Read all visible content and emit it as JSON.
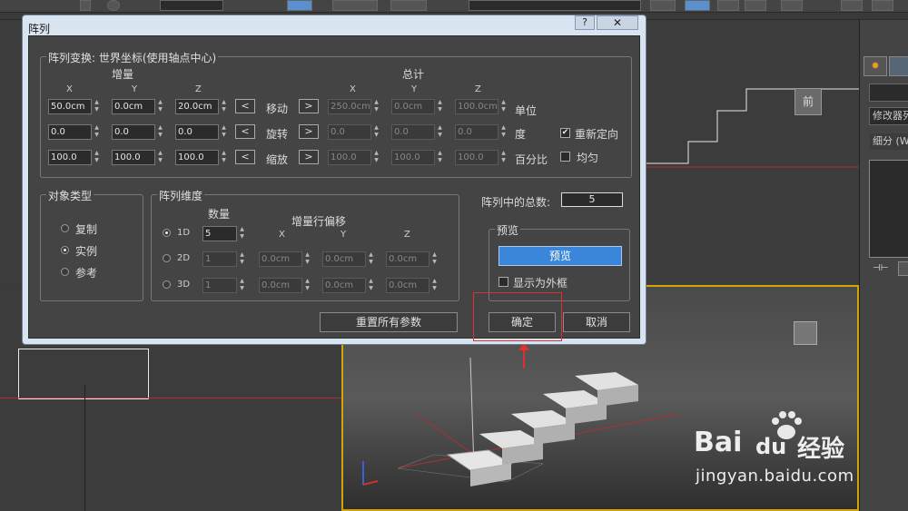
{
  "dialog": {
    "title": "阵列",
    "help_label": "?",
    "close_label": "✕",
    "transform_group": {
      "title": "阵列变换: 世界坐标(使用轴点中心)",
      "increment_header": "增量",
      "total_header": "总计",
      "axes": [
        "X",
        "Y",
        "Z"
      ],
      "rows": [
        {
          "label": "移动",
          "increment": [
            "50.0cm",
            "0.0cm",
            "20.0cm"
          ],
          "total": [
            "250.0cm",
            "0.0cm",
            "100.0cm"
          ],
          "suffix": "单位",
          "left_arrow": "<",
          "right_arrow": ">"
        },
        {
          "label": "旋转",
          "increment": [
            "0.0",
            "0.0",
            "0.0"
          ],
          "total": [
            "0.0",
            "0.0",
            "0.0"
          ],
          "suffix": "度",
          "left_arrow": "<",
          "right_arrow": ">"
        },
        {
          "label": "缩放",
          "increment": [
            "100.0",
            "100.0",
            "100.0"
          ],
          "total": [
            "100.0",
            "100.0",
            "100.0"
          ],
          "suffix": "百分比",
          "left_arrow": "<",
          "right_arrow": ">"
        }
      ],
      "reorient_label": "重新定向",
      "reorient_checked": true,
      "uniform_label": "均匀",
      "uniform_checked": false
    },
    "object_type_group": {
      "title": "对象类型",
      "options": [
        "复制",
        "实例",
        "参考"
      ],
      "selected": "实例"
    },
    "dimensions_group": {
      "title": "阵列维度",
      "count_header": "数量",
      "offset_header": "增量行偏移",
      "axes": [
        "X",
        "Y",
        "Z"
      ],
      "rows": [
        {
          "label": "1D",
          "count": "5",
          "offsets": [
            "",
            "",
            ""
          ],
          "selected": true
        },
        {
          "label": "2D",
          "count": "1",
          "offsets": [
            "0.0cm",
            "0.0cm",
            "0.0cm"
          ],
          "selected": false
        },
        {
          "label": "3D",
          "count": "1",
          "offsets": [
            "0.0cm",
            "0.0cm",
            "0.0cm"
          ],
          "selected": false
        }
      ]
    },
    "total_in_array_label": "阵列中的总数:",
    "total_in_array_value": "5",
    "preview_group": {
      "title": "预览",
      "preview_button": "预览",
      "show_box_label": "显示为外框",
      "show_box_checked": false
    },
    "reset_button": "重置所有参数",
    "ok_button": "确定",
    "cancel_button": "取消"
  },
  "command_panel": {
    "modifier_list": "修改器列",
    "subdivide": "细分 (W"
  },
  "viewport": {
    "cube_label": "前"
  },
  "watermark": {
    "brand": "Bai",
    "brand2": "du",
    "brand_cn": "经验",
    "url": "jingyan.baidu.com"
  },
  "colors": {
    "dialog_frame": "#d9e4f1",
    "dialog_body": "#444444",
    "preview_blue": "#3b86d8",
    "highlight_red": "#e03030",
    "active_viewport": "#d6a400"
  }
}
